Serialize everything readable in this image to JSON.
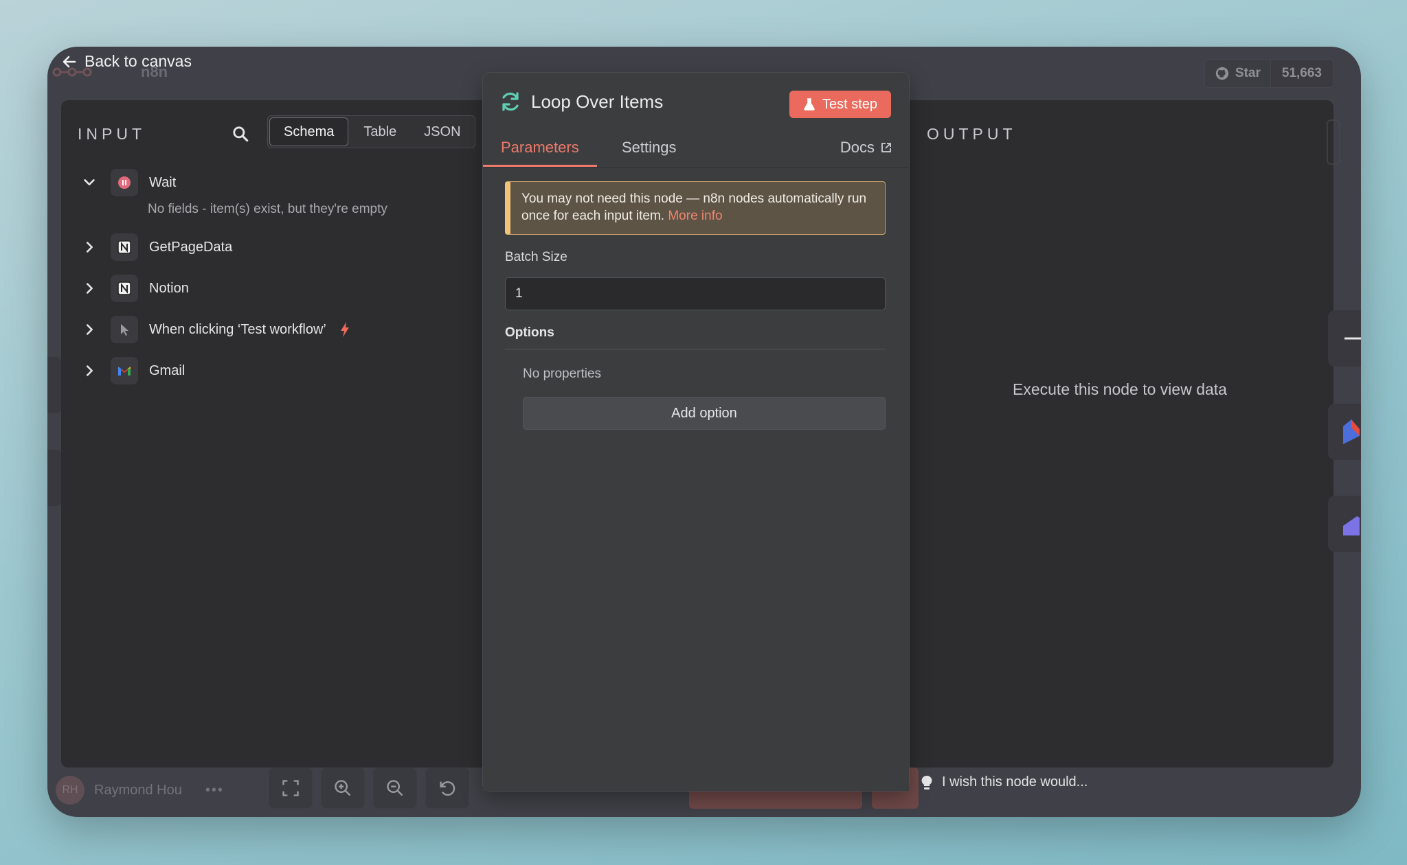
{
  "header": {
    "back_label": "Back to canvas",
    "logo_text": "n8n",
    "github_star_label": "Star",
    "github_star_count": "51,663"
  },
  "input": {
    "title": "INPUT",
    "view_tabs": [
      "Schema",
      "Table",
      "JSON"
    ],
    "active_tab": "Schema",
    "nodes": [
      {
        "label": "Wait",
        "expanded": true,
        "icon": "pause-icon",
        "note": "No fields - item(s) exist, but they're empty"
      },
      {
        "label": "GetPageData",
        "expanded": false,
        "icon": "notion-icon"
      },
      {
        "label": "Notion",
        "expanded": false,
        "icon": "notion-icon"
      },
      {
        "label": "When clicking ‘Test workflow’",
        "expanded": false,
        "icon": "pointer-icon",
        "trigger": true
      },
      {
        "label": "Gmail",
        "expanded": false,
        "icon": "gmail-icon"
      }
    ]
  },
  "modal": {
    "title": "Loop Over Items",
    "test_button": "Test step",
    "tabs": {
      "parameters": "Parameters",
      "settings": "Settings",
      "docs": "Docs"
    },
    "notice_text": "You may not need this node — n8n nodes automatically run once for each input item.",
    "notice_link": "More info",
    "batch_size_label": "Batch Size",
    "batch_size_value": "1",
    "options_label": "Options",
    "no_properties": "No properties",
    "add_option": "Add option"
  },
  "output": {
    "title": "OUTPUT",
    "empty_message": "Execute this node to view data"
  },
  "footer": {
    "user_initials": "RH",
    "user_name": "Raymond Hou",
    "feedback": "I wish this node would..."
  },
  "colors": {
    "accent": "#ea6b5d",
    "notice_bg": "#5d5446",
    "notice_border": "#f1c27a",
    "panel_bg": "#2d2d2f",
    "modal_bg": "#3c3d3f"
  }
}
